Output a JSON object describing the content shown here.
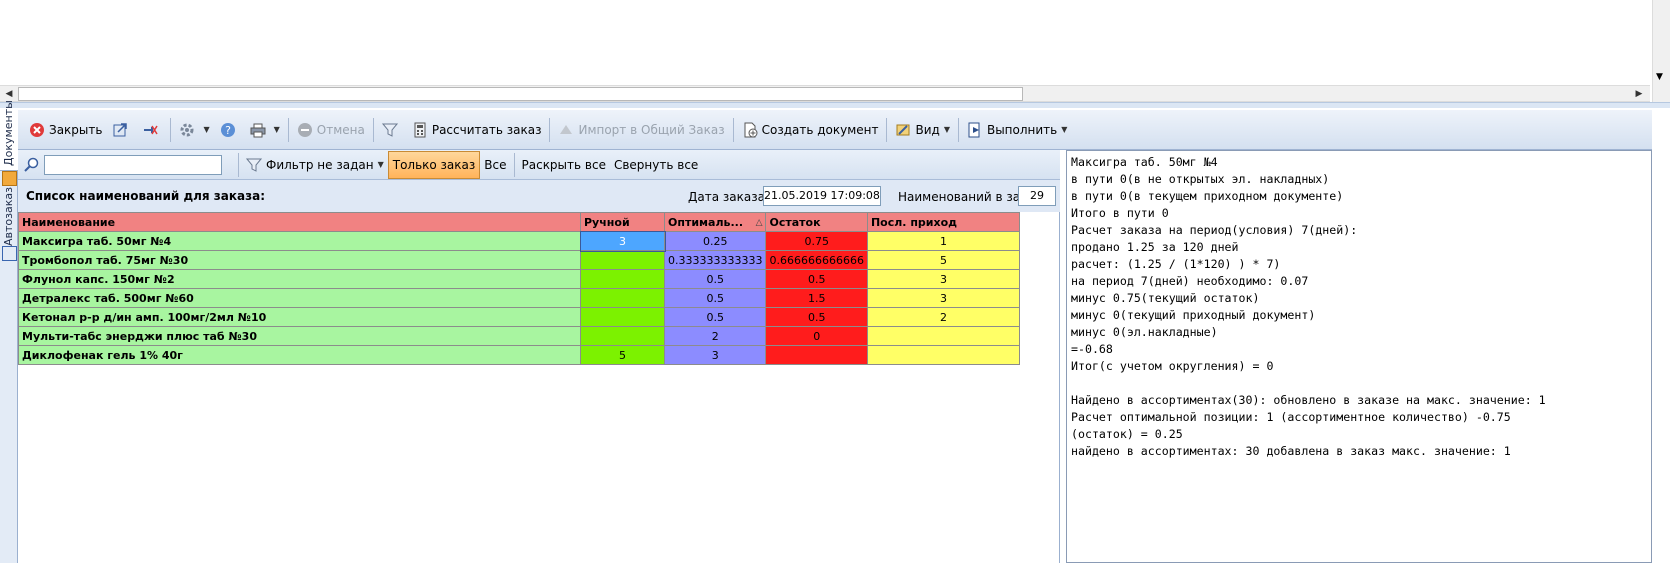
{
  "side_tabs": [
    "Документы",
    "Автозаказ"
  ],
  "toolbar": {
    "close": "Закрыть",
    "cancel": "Отмена",
    "calculate": "Рассчитать заказ",
    "import": "Импорт в Общий Заказ",
    "create_doc": "Создать документ",
    "view": "Вид",
    "execute": "Выполнить"
  },
  "filterbar": {
    "search_placeholder": "",
    "filter": "Фильтр не задан",
    "only_order": "Только заказ",
    "all": "Все",
    "expand_all": "Раскрыть все",
    "collapse_all": "Свернуть все"
  },
  "list": {
    "title": "Список наименований для заказа:",
    "order_date_label": "Дата заказа",
    "order_date": "21.05.2019 17:09:08",
    "count_label": "Наименований в заказе",
    "count": "29"
  },
  "grid": {
    "columns": [
      "Наименование",
      "Ручной",
      "Оптималь...",
      "Остаток",
      "Посл. приход"
    ],
    "rows": [
      {
        "name": "Максигра таб. 50мг №4",
        "manual": "3",
        "optimal": "0.25",
        "rest": "0.75",
        "last": "1"
      },
      {
        "name": "Тромбопол таб. 75мг №30",
        "manual": "",
        "optimal": "0.333333333333",
        "rest": "0.666666666666",
        "last": "5"
      },
      {
        "name": "Флунол капс. 150мг №2",
        "manual": "",
        "optimal": "0.5",
        "rest": "0.5",
        "last": "3"
      },
      {
        "name": "Детралекс таб. 500мг №60",
        "manual": "",
        "optimal": "0.5",
        "rest": "1.5",
        "last": "3"
      },
      {
        "name": "Кетонал р-р д/ин амп. 100мг/2мл №10",
        "manual": "",
        "optimal": "0.5",
        "rest": "0.5",
        "last": "2"
      },
      {
        "name": "Мульти-табс энерджи плюс таб №30",
        "manual": "",
        "optimal": "2",
        "rest": "0",
        "last": ""
      },
      {
        "name": "Диклофенак гель 1% 40г",
        "manual": "5",
        "optimal": "3",
        "rest": "",
        "last": ""
      }
    ]
  },
  "log": [
    "Максигра таб. 50мг №4",
    "в пути 0(в не открытых эл. накладных)",
    "в пути 0(в текущем приходном документе)",
    "Итого в пути 0",
    "Расчет заказа на период(условия) 7(дней):",
    "продано 1.25 за 120 дней",
    "расчет: (1.25 / (1*120) ) * 7)",
    "на период 7(дней) необходимо: 0.07",
    "минус 0.75(текущий остаток)",
    "минус 0(текущий приходный документ)",
    "минус 0(эл.накладные)",
    "=-0.68",
    "Итог(с учетом округления) = 0",
    "",
    "Найдено в ассортиментах(30): обновлено в заказе на макс. значение: 1",
    "Расчет оптимальной позиции: 1 (ассортиментное количество) -0.75",
    "(остаток) = 0.25",
    "найдено в ассортиментах: 30 добавлена в заказ макс. значение: 1"
  ]
}
